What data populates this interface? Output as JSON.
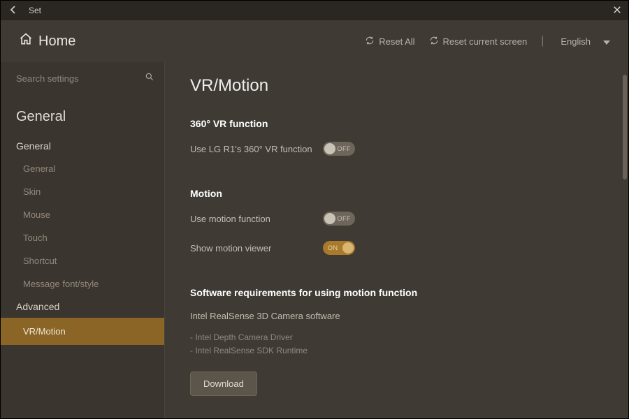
{
  "titlebar": {
    "title": "Set"
  },
  "header": {
    "home": "Home",
    "reset_all": "Reset All",
    "reset_screen": "Reset current screen",
    "language": "English"
  },
  "search": {
    "placeholder": "Search settings"
  },
  "sidebar": {
    "categoryLabel": "General",
    "groupGeneral": "General",
    "items": {
      "general": "General",
      "skin": "Skin",
      "mouse": "Mouse",
      "touch": "Touch",
      "shortcut": "Shortcut",
      "msgfont": "Message font/style"
    },
    "groupAdvanced": "Advanced",
    "adv": {
      "vrmotion": "VR/Motion"
    }
  },
  "page": {
    "title": "VR/Motion",
    "sec_vr": {
      "title": "360° VR function",
      "use_vr": "Use LG R1's 360° VR function",
      "use_vr_toggle": "OFF"
    },
    "sec_motion": {
      "title": "Motion",
      "use_motion": "Use motion function",
      "use_motion_toggle": "OFF",
      "show_viewer": "Show motion viewer",
      "show_viewer_toggle": "ON"
    },
    "sec_req": {
      "title": "Software requirements for using motion function",
      "desc": "Intel RealSense 3D Camera software",
      "item1": "- Intel Depth Camera Driver",
      "item2": "- Intel RealSense SDK Runtime",
      "download": "Download"
    }
  }
}
